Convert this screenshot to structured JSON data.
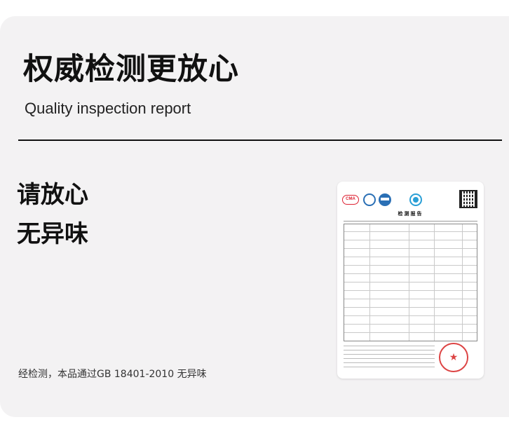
{
  "header": {
    "title": "权威检测更放心",
    "subtitle": "Quality inspection report"
  },
  "taglines": [
    "请放心",
    "无异味"
  ],
  "document": {
    "heading": "检测报告",
    "logo_cma": "CMA",
    "stamp_symbol": "★"
  },
  "footer": {
    "text": "经检测，本品通过GB 18401-2010   无异味"
  },
  "colors": {
    "background": "#f3f2f3",
    "text": "#111111",
    "stamp": "#d93030"
  }
}
